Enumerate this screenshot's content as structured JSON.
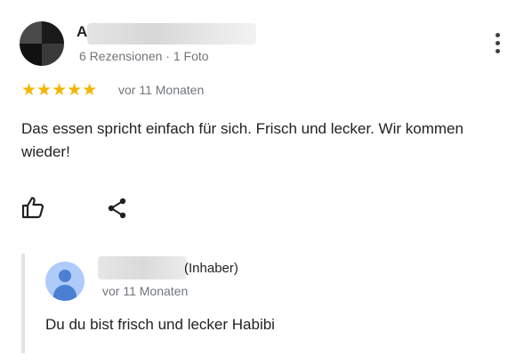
{
  "review": {
    "reviewer_initial": "A",
    "reviewer_meta": "6 Rezensionen · 1 Foto",
    "stars": "★★★★★",
    "rating": 5,
    "age": "vor 11 Monaten",
    "text": "Das essen spricht einfach für sich. Frisch und lecker. Wir kommen wieder!"
  },
  "reply": {
    "role": "(Inhaber)",
    "age": "vor 11 Monaten",
    "text": "Du du bist frisch und lecker Habibi"
  },
  "icons": {
    "more": "more-vert-icon",
    "like": "thumbs-up-icon",
    "share": "share-icon",
    "owner_avatar": "person-icon"
  },
  "colors": {
    "star": "#f5b400",
    "muted_text": "#70757a",
    "owner_avatar_bg": "#aecbfa",
    "owner_avatar_fg": "#4a7fd1"
  }
}
